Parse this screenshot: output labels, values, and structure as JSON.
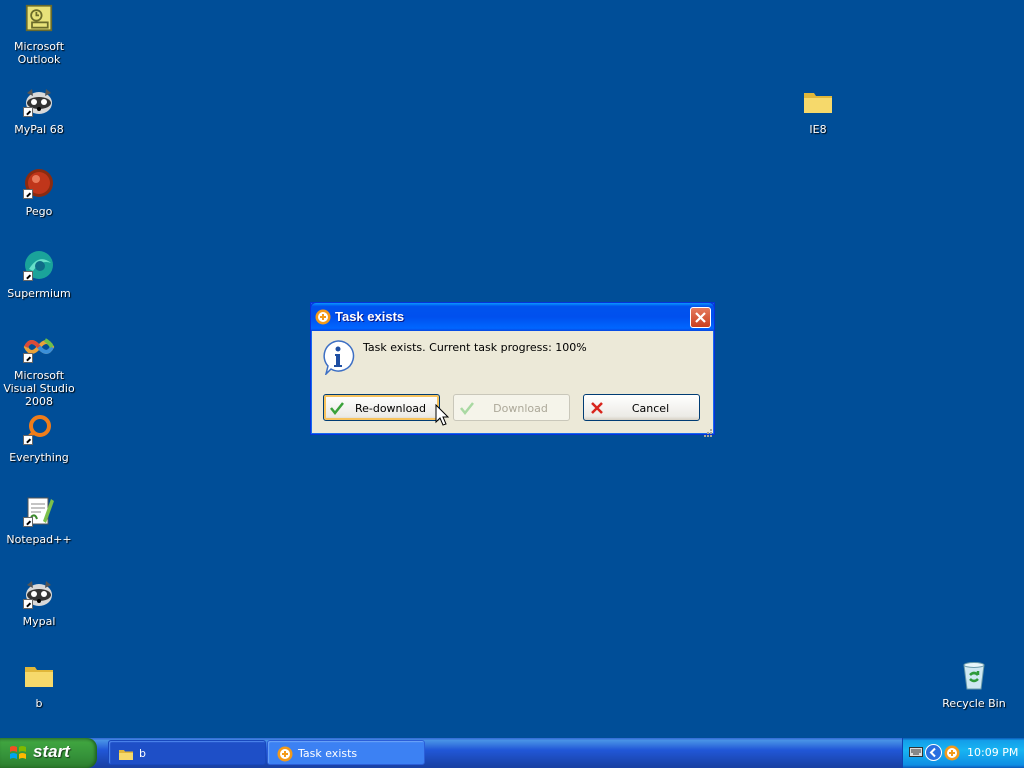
{
  "desktop": {
    "icons": [
      {
        "label": "Microsoft\nOutlook",
        "icon": "outlook-icon"
      },
      {
        "label": "MyPal 68",
        "icon": "mypal-icon"
      },
      {
        "label": "Pego",
        "icon": "pego-icon"
      },
      {
        "label": "Supermium",
        "icon": "supermium-icon"
      },
      {
        "label": "Microsoft Visual Studio 2008",
        "icon": "visual-studio-icon"
      },
      {
        "label": "Everything",
        "icon": "everything-icon"
      },
      {
        "label": "Notepad++",
        "icon": "notepadpp-icon"
      },
      {
        "label": "Mypal",
        "icon": "mypal-icon"
      },
      {
        "label": "b",
        "icon": "folder-icon"
      },
      {
        "label": "IE8",
        "icon": "folder-icon"
      },
      {
        "label": "Recycle Bin",
        "icon": "recycle-bin-icon"
      }
    ]
  },
  "dialog": {
    "title": "Task exists",
    "message": "Task exists. Current task progress: 100%",
    "buttons": {
      "redownload": "Re-download",
      "download": "Download",
      "cancel": "Cancel"
    }
  },
  "taskbar": {
    "start_label": "start",
    "tasks": [
      {
        "label": "b",
        "icon": "folder-icon"
      },
      {
        "label": "Task exists",
        "icon": "app-icon"
      }
    ],
    "clock": "10:09 PM"
  },
  "colors": {
    "desktop_bg": "#004e98",
    "titlebar_blue": "#0053ee",
    "start_green": "#3fa43f"
  }
}
